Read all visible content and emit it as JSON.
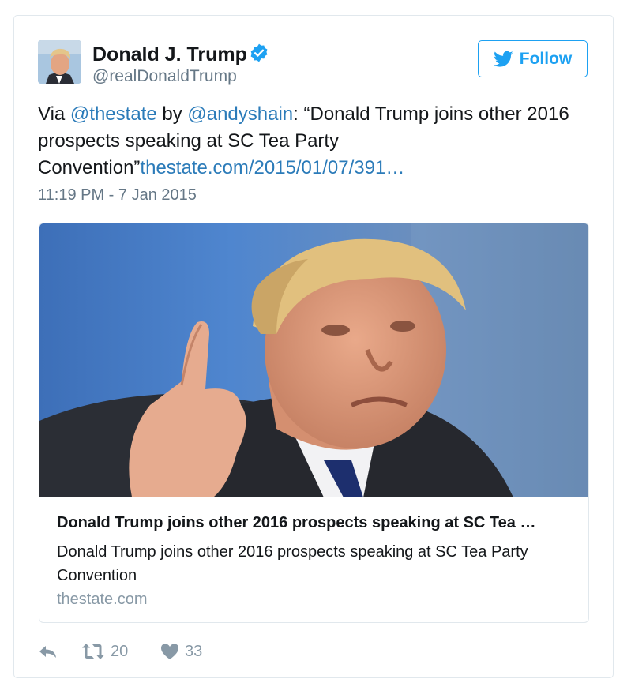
{
  "tweet": {
    "author": {
      "name": "Donald J. Trump",
      "handle": "@realDonaldTrump"
    },
    "follow_label": "Follow",
    "text": {
      "prefix": "Via ",
      "mention1": "@thestate",
      "middle": " by ",
      "mention2": "@andyshain",
      "body": ": “Donald Trump joins other 2016 prospects speaking at SC Tea Party Convention”",
      "url": "thestate.com/2015/01/07/391…"
    },
    "timestamp": "11:19 PM - 7 Jan 2015",
    "card": {
      "title": "Donald Trump joins other 2016 prospects speaking at SC Tea …",
      "description": "Donald Trump joins other 2016 prospects speaking at SC Tea Party Convention",
      "domain": "thestate.com"
    },
    "actions": {
      "retweet_count": "20",
      "like_count": "33"
    },
    "colors": {
      "accent": "#1da1f2",
      "link": "#2b7bb9",
      "muted": "#657786"
    },
    "icons": [
      "verified-badge-icon",
      "twitter-bird-icon",
      "reply-icon",
      "retweet-icon",
      "heart-icon"
    ]
  }
}
